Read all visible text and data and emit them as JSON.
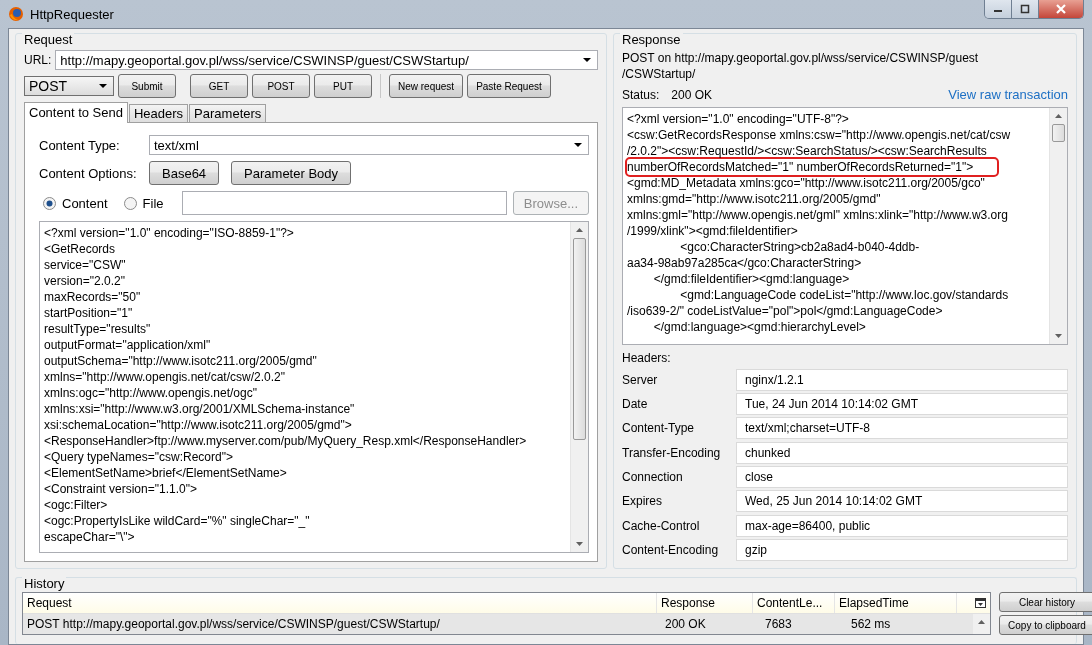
{
  "window": {
    "title": "HttpRequester"
  },
  "request": {
    "title": "Request",
    "url_label": "URL:",
    "url": "http://mapy.geoportal.gov.pl/wss/service/CSWINSP/guest/CSWStartup/",
    "method": "POST",
    "action_buttons": [
      "Submit",
      "GET",
      "POST",
      "PUT"
    ],
    "extra_buttons": [
      "New request",
      "Paste Request"
    ],
    "tabs": [
      {
        "label": "Content to Send",
        "selected": true
      },
      {
        "label": "Headers",
        "selected": false
      },
      {
        "label": "Parameters",
        "selected": false
      }
    ],
    "content_type_label": "Content Type:",
    "content_type": "text/xml",
    "content_options_label": "Content Options:",
    "content_options": [
      "Base64",
      "Parameter Body"
    ],
    "sources": [
      {
        "label": "Content",
        "selected": true
      },
      {
        "label": "File",
        "selected": false
      }
    ],
    "browse_button": {
      "label": "Browse...",
      "disabled": true
    },
    "body_lines": [
      "<?xml version=\"1.0\" encoding=\"ISO-8859-1\"?>",
      "<GetRecords",
      "service=\"CSW\"",
      "version=\"2.0.2\"",
      "maxRecords=\"50\"",
      "startPosition=\"1\"",
      "resultType=\"results\"",
      "outputFormat=\"application/xml\"",
      "outputSchema=\"http://www.isotc211.org/2005/gmd\"",
      "xmlns=\"http://www.opengis.net/cat/csw/2.0.2\"",
      "xmlns:ogc=\"http://www.opengis.net/ogc\"",
      "xmlns:xsi=\"http://www.w3.org/2001/XMLSchema-instance\"",
      "xsi:schemaLocation=\"http://www.isotc211.org/2005/gmd\">",
      "<ResponseHandler>ftp://www.myserver.com/pub/MyQuery_Resp.xml</ResponseHandler>",
      "<Query typeNames=\"csw:Record\">",
      "<ElementSetName>brief</ElementSetName>",
      "<Constraint version=\"1.1.0\">",
      "<ogc:Filter>",
      "<ogc:PropertyIsLike wildCard=\"%\" singleChar=\"_\"",
      "escapeChar=\"\\\">"
    ]
  },
  "response": {
    "title": "Response",
    "summary_lines": [
      "POST on http://mapy.geoportal.gov.pl/wss/service/CSWINSP/guest",
      "/CSWStartup/"
    ],
    "status_label": "Status:",
    "status": "200 OK",
    "raw_link": "View raw transaction",
    "body_lines": [
      {
        "text": "<?xml version=\"1.0\" encoding=\"UTF-8\"?>",
        "highlighted": false
      },
      {
        "text": "<csw:GetRecordsResponse xmlns:csw=\"http://www.opengis.net/cat/csw",
        "highlighted": false
      },
      {
        "text": "/2.0.2\"><csw:RequestId/><csw:SearchStatus/><csw:SearchResults",
        "highlighted": false
      },
      {
        "text": "numberOfRecordsMatched=\"1\" numberOfRecordsReturned=\"1\">",
        "highlighted": true
      },
      {
        "text": "<gmd:MD_Metadata xmlns:gco=\"http://www.isotc211.org/2005/gco\"",
        "highlighted": false
      },
      {
        "text": "xmlns:gmd=\"http://www.isotc211.org/2005/gmd\"",
        "highlighted": false
      },
      {
        "text": "xmlns:gml=\"http://www.opengis.net/gml\" xmlns:xlink=\"http://www.w3.org",
        "highlighted": false
      },
      {
        "text": "/1999/xlink\"><gmd:fileIdentifier>",
        "highlighted": false
      },
      {
        "text": "                <gco:CharacterString>cb2a8ad4-b040-4ddb-",
        "highlighted": false
      },
      {
        "text": "aa34-98ab97a285ca</gco:CharacterString>",
        "highlighted": false
      },
      {
        "text": "        </gmd:fileIdentifier><gmd:language>",
        "highlighted": false
      },
      {
        "text": "                <gmd:LanguageCode codeList=\"http://www.loc.gov/standards",
        "highlighted": false
      },
      {
        "text": "/iso639-2/\" codeListValue=\"pol\">pol</gmd:LanguageCode>",
        "highlighted": false
      },
      {
        "text": "        </gmd:language><gmd:hierarchyLevel>",
        "highlighted": false
      }
    ],
    "headers_label": "Headers:",
    "headers": [
      {
        "name": "Server",
        "value": "nginx/1.2.1"
      },
      {
        "name": "Date",
        "value": "Tue, 24 Jun 2014 10:14:02 GMT"
      },
      {
        "name": "Content-Type",
        "value": "text/xml;charset=UTF-8"
      },
      {
        "name": "Transfer-Encoding",
        "value": "chunked"
      },
      {
        "name": "Connection",
        "value": "close"
      },
      {
        "name": "Expires",
        "value": "Wed, 25 Jun 2014 10:14:02 GMT"
      },
      {
        "name": "Cache-Control",
        "value": "max-age=86400, public"
      },
      {
        "name": "Content-Encoding",
        "value": "gzip"
      }
    ]
  },
  "history": {
    "title": "History",
    "columns": [
      "Request",
      "Response",
      "ContentLe...",
      "ElapsedTime"
    ],
    "rows": [
      {
        "cells": [
          "POST http://mapy.geoportal.gov.pl/wss/service/CSWINSP/guest/CSWStartup/",
          "200 OK",
          "7683",
          "562 ms"
        ],
        "selected": true
      }
    ],
    "buttons": [
      "Clear history",
      "Copy to clipboard"
    ]
  }
}
